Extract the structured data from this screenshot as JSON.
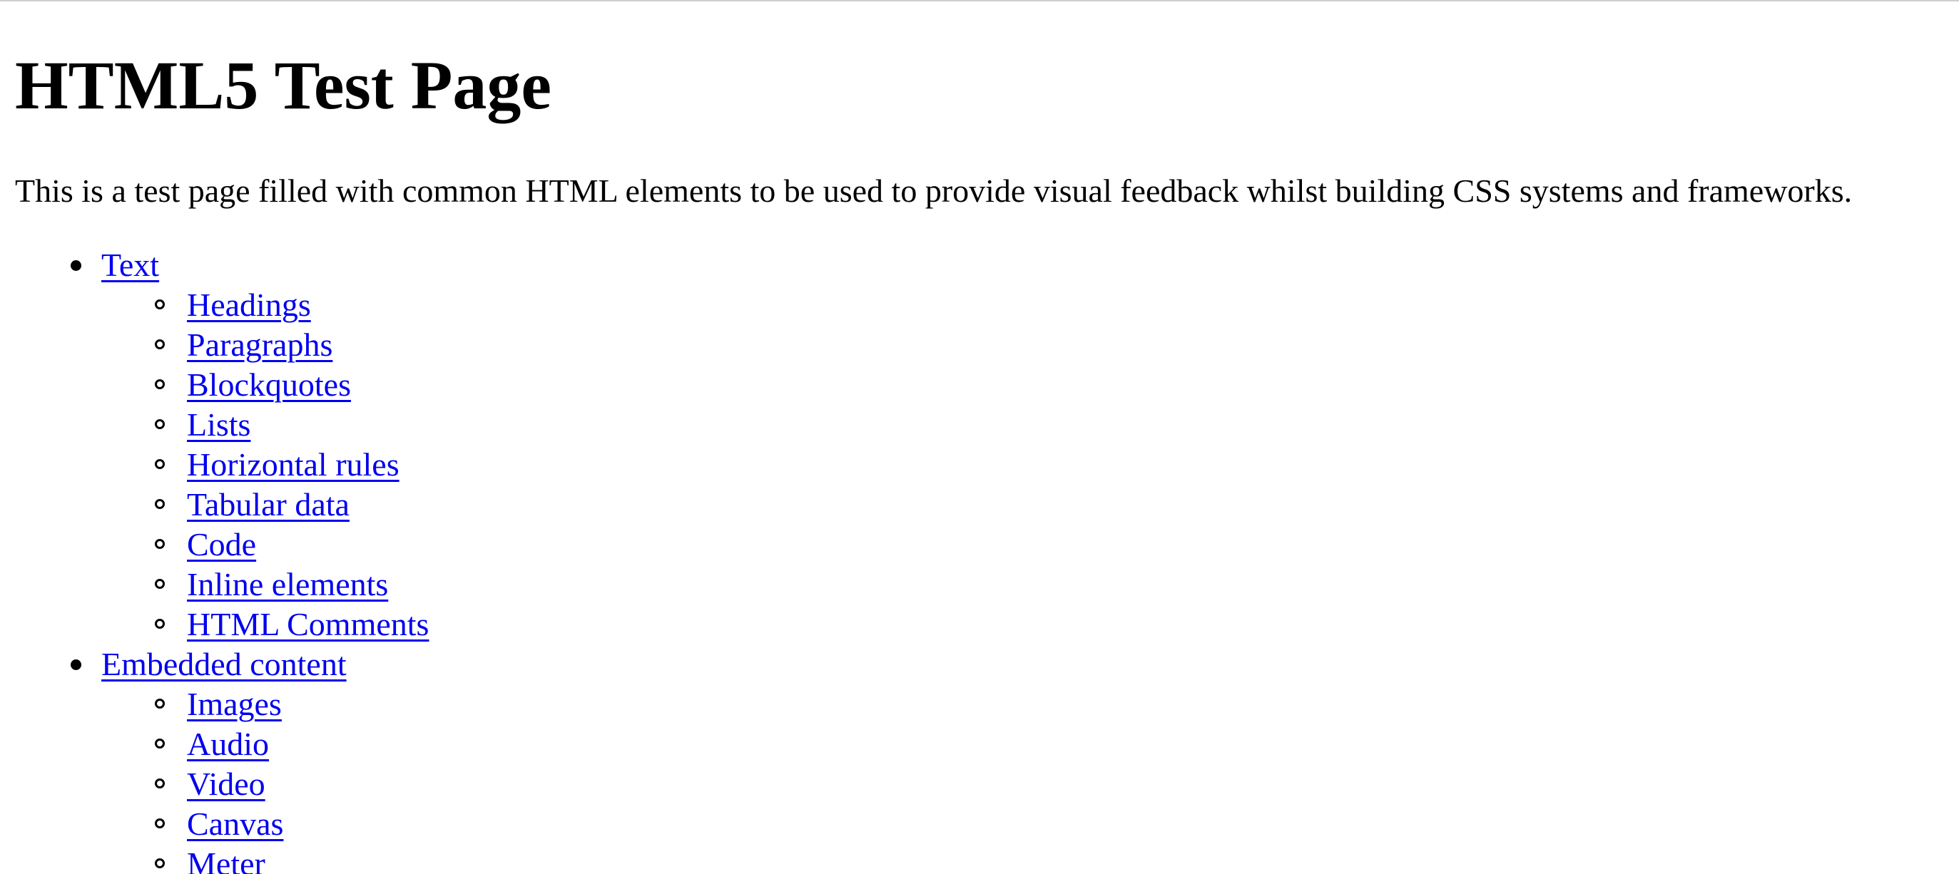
{
  "page": {
    "title": "HTML5 Test Page",
    "intro": "This is a test page filled with common HTML elements to be used to provide visual feedback whilst building CSS systems and frameworks."
  },
  "toc": {
    "text": {
      "label": "Text",
      "children": [
        "Headings",
        "Paragraphs",
        "Blockquotes",
        "Lists",
        "Horizontal rules",
        "Tabular data",
        "Code",
        "Inline elements",
        "HTML Comments"
      ]
    },
    "embedded": {
      "label": "Embedded content",
      "children": [
        "Images",
        "Audio",
        "Video",
        "Canvas",
        "Meter"
      ]
    }
  },
  "colors": {
    "link": "#0000ee",
    "text": "#000000",
    "background": "#ffffff"
  }
}
